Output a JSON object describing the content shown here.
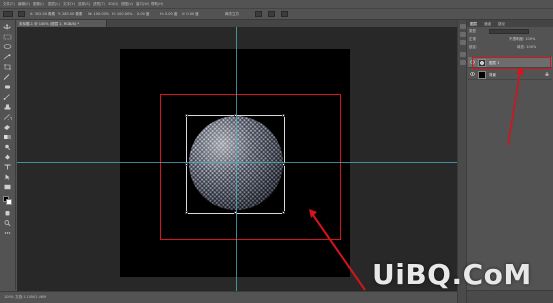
{
  "menubar": {
    "items": [
      "文件(F)",
      "编辑(E)",
      "图像(I)",
      "图层(L)",
      "文字(Y)",
      "选择(S)",
      "滤镜(T)",
      "3D(D)",
      "视图(V)",
      "窗口(W)",
      "帮助(H)"
    ]
  },
  "options": {
    "x_value": "X: 302.00 像素",
    "y_value": "Y: 283.50 像素",
    "w_value": "W: 100.00%",
    "h_value": "H: 100.00%",
    "angle_value": "0.00 度",
    "h_skew": "H: 0.00 度",
    "v_skew": "V: 0.00 度",
    "interp": "两次立方"
  },
  "document_tab": {
    "title": "未标题-1 @ 100% (图层 1, RGB/8) *"
  },
  "statusbar": {
    "text": "100%    文档:1.10M/1.46M"
  },
  "layers_panel": {
    "tabs": [
      "图层",
      "通道",
      "路径"
    ],
    "kind_label": "类型",
    "blend_mode": "正常",
    "opacity_label": "不透明度: 100%",
    "lock_label": "锁定:",
    "fill_label": "填充: 100%",
    "layers": [
      {
        "name": "图层 1",
        "selected": true,
        "thumb": "sphere"
      },
      {
        "name": "背景",
        "selected": false,
        "thumb": "black"
      }
    ]
  },
  "watermark": {
    "text": "UiBQ.CoM",
    "sub": ""
  },
  "colors": {
    "accent_red": "#d5141b",
    "guide": "#4fb3c7",
    "document": "#000000",
    "pasteboard": "#282828",
    "chrome": "#535353"
  }
}
